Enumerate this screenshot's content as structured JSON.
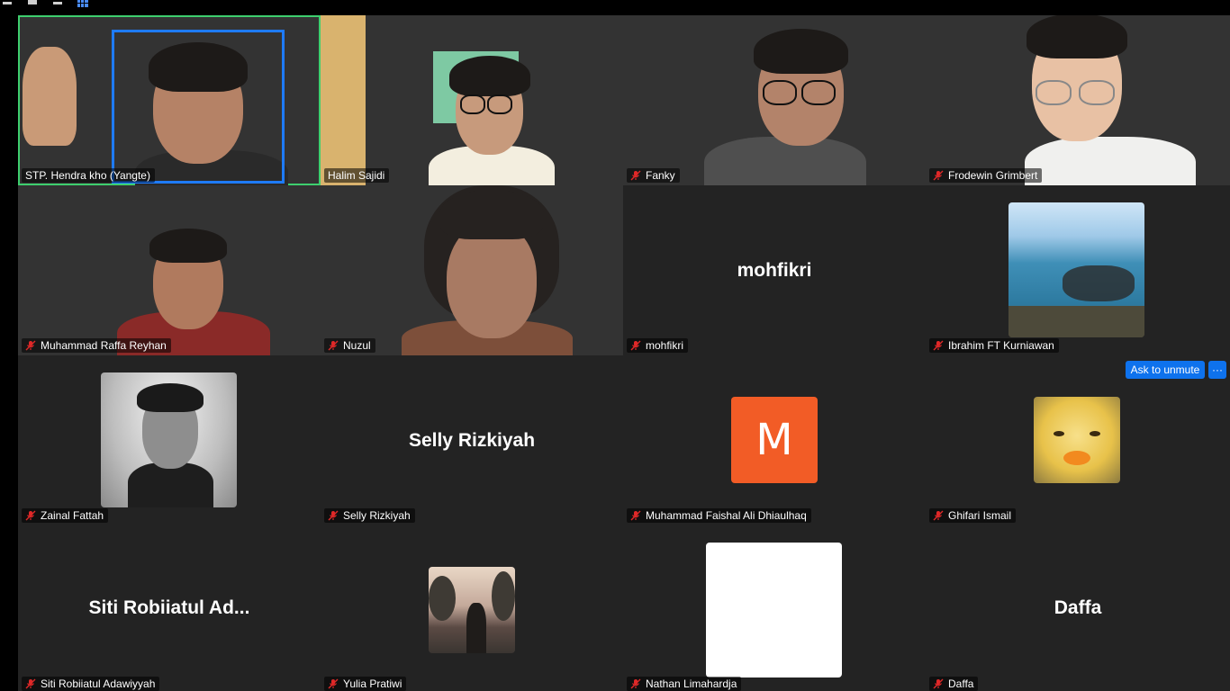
{
  "toolbar": {
    "icons": [
      "minimize-icon",
      "restore-icon",
      "minimize-icon",
      "gallery-view-icon"
    ],
    "active_icon_color": "#4a8cff"
  },
  "accent_colors": {
    "active_speaker": "#3ecf6e",
    "button_blue": "#0e72ed",
    "mic_off_red": "#e02828",
    "tile_background": "#232323"
  },
  "participants": [
    {
      "name": "STP. Hendra kho (Yangte)",
      "muted": false,
      "video": true,
      "active_speaker": true
    },
    {
      "name": "Halim Sajidi",
      "muted": false,
      "video": true
    },
    {
      "name": "Fanky",
      "muted": true,
      "video": true
    },
    {
      "name": "Frodewin Grimbert",
      "muted": true,
      "video": true
    },
    {
      "name": "Muhammad Raffa Reyhan",
      "muted": true,
      "video": true
    },
    {
      "name": "Nuzul",
      "muted": true,
      "video": true
    },
    {
      "name": "mohfikri",
      "muted": true,
      "video": false,
      "display_name": "mohfikri"
    },
    {
      "name": "Ibrahim FT Kurniawan",
      "muted": true,
      "video": false,
      "avatar": "photo"
    },
    {
      "name": "Zainal Fattah",
      "muted": true,
      "video": false,
      "avatar": "photo"
    },
    {
      "name": "Selly Rizkiyah",
      "muted": true,
      "video": false,
      "display_name": "Selly Rizkiyah"
    },
    {
      "name": "Muhammad Faishal Ali Dhiaulhaq",
      "muted": true,
      "video": false,
      "avatar": "initial",
      "initial": "M"
    },
    {
      "name": "Ghifari Ismail",
      "muted": true,
      "video": false,
      "avatar": "photo"
    },
    {
      "name": "Siti Robiiatul Adawiyyah",
      "muted": true,
      "video": false,
      "display_name": "Siti  Robiiatul  Ad..."
    },
    {
      "name": "Yulia Pratiwi",
      "muted": true,
      "video": false,
      "avatar": "photo"
    },
    {
      "name": "Nathan Limahardja",
      "muted": true,
      "video": false,
      "avatar": "blank"
    },
    {
      "name": "Daffa",
      "muted": true,
      "video": false,
      "display_name": "Daffa"
    }
  ],
  "actions": {
    "ask_to_unmute": "Ask to unmute",
    "more": "···"
  }
}
